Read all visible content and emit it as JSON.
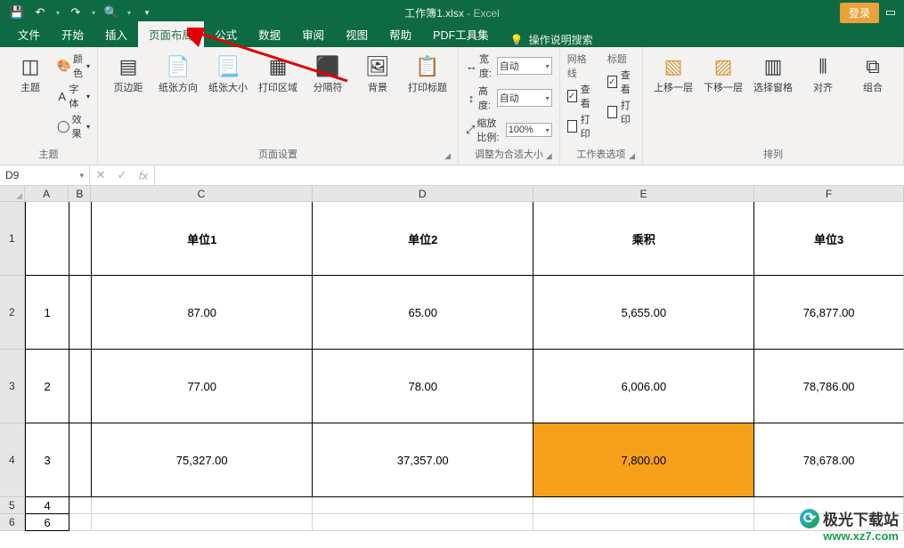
{
  "title": {
    "file": "工作簿1.xlsx",
    "app": "Excel",
    "sep": " - "
  },
  "login": "登录",
  "tabs": {
    "file": "文件",
    "home": "开始",
    "insert": "插入",
    "pagelayout": "页面布局",
    "formulas": "公式",
    "data": "数据",
    "review": "审阅",
    "view": "视图",
    "help": "帮助",
    "pdf": "PDF工具集",
    "tellme": "操作说明搜索"
  },
  "groups": {
    "themes": {
      "label": "主题",
      "theme": "主题",
      "colors": "颜色",
      "fonts": "字体",
      "effects": "效果"
    },
    "pagesetup": {
      "label": "页面设置",
      "margins": "页边距",
      "orientation": "纸张方向",
      "size": "纸张大小",
      "printarea": "打印区域",
      "breaks": "分隔符",
      "background": "背景",
      "printtitles": "打印标题"
    },
    "scale": {
      "label": "调整为合适大小",
      "width": "宽度:",
      "height": "高度:",
      "auto": "自动",
      "scalepct": "缩放比例:",
      "pct": "100%"
    },
    "sheetopts": {
      "label": "工作表选项",
      "gridlines": "网格线",
      "headings": "标题",
      "view": "查看",
      "print": "打印"
    },
    "arrange": {
      "label": "排列",
      "forward": "上移一层",
      "backward": "下移一层",
      "selpane": "选择窗格",
      "align": "对齐",
      "group": "组合"
    }
  },
  "namebox": "D9",
  "sheet": {
    "cols": [
      "A",
      "B",
      "C",
      "D",
      "E",
      "F"
    ],
    "header": {
      "C": "单位1",
      "D": "单位2",
      "E": "乘积",
      "F": "单位3"
    },
    "rows": [
      {
        "A": "1",
        "C": "87.00",
        "D": "65.00",
        "E": "5,655.00",
        "F": "76,877.00"
      },
      {
        "A": "2",
        "C": "77.00",
        "D": "78.00",
        "E": "6,006.00",
        "F": "78,786.00"
      },
      {
        "A": "3",
        "C": "75,327.00",
        "D": "37,357.00",
        "E": "7,800.00",
        "F": "78,678.00"
      }
    ],
    "tail": [
      "4",
      "6"
    ]
  },
  "watermark": {
    "l1": "极光下载站",
    "l2": "www.xz7.com"
  }
}
